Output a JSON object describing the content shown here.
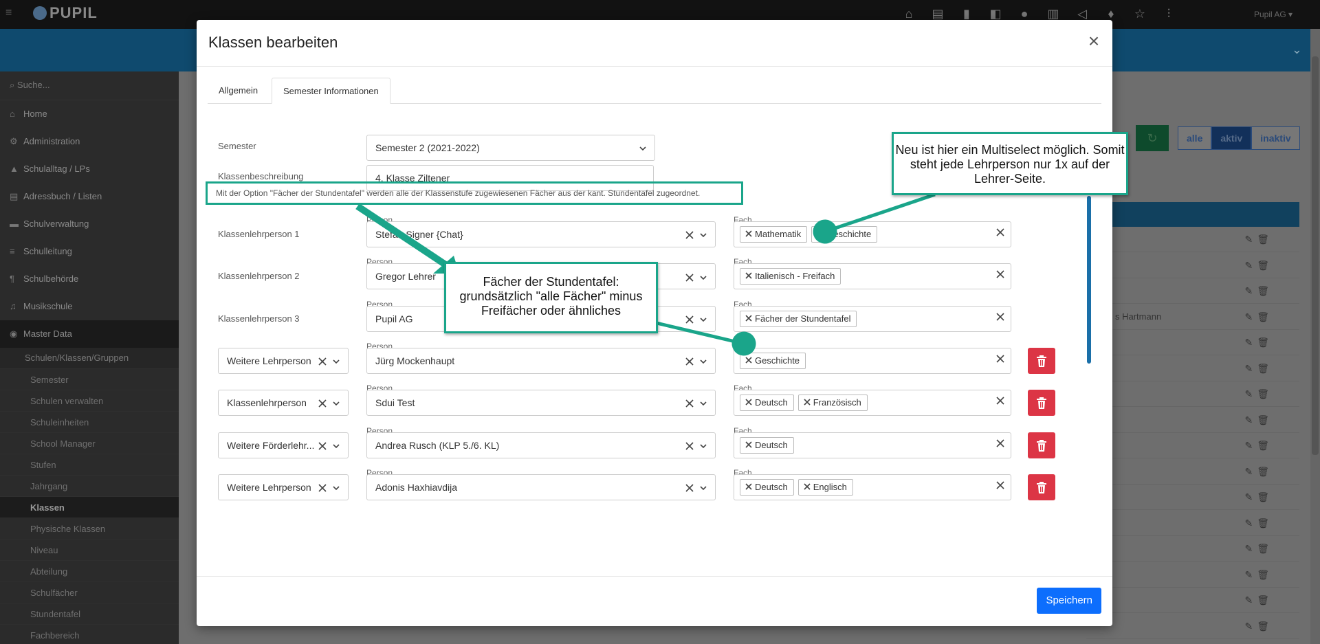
{
  "app": {
    "logo": "PUPIL",
    "user": "Pupil AG ▾",
    "search_placeholder": "Suche...",
    "nav": [
      {
        "label": "Home",
        "icon": "home-icon"
      },
      {
        "label": "Administration",
        "icon": "gear-icon"
      },
      {
        "label": "Schulalltag / LPs",
        "icon": "graduation-cap-icon"
      },
      {
        "label": "Adressbuch / Listen",
        "icon": "address-book-icon"
      },
      {
        "label": "Schulverwaltung",
        "icon": "folder-icon"
      },
      {
        "label": "Schulleitung",
        "icon": "sliders-icon"
      },
      {
        "label": "Schulbehörde",
        "icon": "paragraph-icon"
      },
      {
        "label": "Musikschule",
        "icon": "music-icon"
      },
      {
        "label": "Master Data",
        "icon": "database-icon"
      }
    ],
    "sub_head": "Schulen/Klassen/Gruppen",
    "sub_items": [
      "Semester",
      "Schulen verwalten",
      "Schuleinheiten",
      "School Manager",
      "Stufen",
      "Jahrgang",
      "Klassen",
      "Physische Klassen",
      "Niveau",
      "Abteilung",
      "Schulfächer",
      "Stundentafel",
      "Fachbereich"
    ],
    "filters": [
      "alle",
      "aktiv",
      "inaktiv"
    ],
    "bg_row_text": "s Hartmann"
  },
  "modal": {
    "title": "Klassen bearbeiten",
    "tabs": [
      "Allgemein",
      "Semester Informationen"
    ],
    "semester_label": "Semester",
    "semester_value": "Semester 2 (2021-2022)",
    "desc_label": "Klassenbeschreibung",
    "desc_value": "4. Klasse Ziltener",
    "info_note": "Mit der Option \"Fächer der Stundentafel\" werden alle der Klassenstufe zugewiesenen Fächer aus der kant. Stundentafel zugeordnet.",
    "person_label": "Person",
    "fach_label": "Fach",
    "rows": [
      {
        "role": "Klassenlehrperson 1",
        "person": "Stefan Signer {Chat}",
        "subjects": [
          "Mathematik",
          "Geschichte"
        ]
      },
      {
        "role": "Klassenlehrperson 2",
        "person": "Gregor Lehrer",
        "subjects": [
          "Italienisch - Freifach"
        ]
      },
      {
        "role": "Klassenlehrperson 3",
        "person": "Pupil AG",
        "subjects": [
          "Fächer der Stundentafel"
        ]
      },
      {
        "role_select": "Weitere Lehrperson",
        "person": "Jürg Mockenhaupt",
        "subjects": [
          "Geschichte"
        ]
      },
      {
        "role_select": "Klassenlehrperson",
        "person": "Sdui Test",
        "subjects": [
          "Deutsch",
          "Französisch"
        ]
      },
      {
        "role_select": "Weitere Förderlehr...",
        "person": "Andrea Rusch (KLP 5./6. KL)",
        "subjects": [
          "Deutsch"
        ]
      },
      {
        "role_select": "Weitere Lehrperson",
        "person": "Adonis Haxhiavdija",
        "subjects": [
          "Deutsch",
          "Englisch"
        ]
      }
    ],
    "save_label": "Speichern"
  },
  "annotations": {
    "multiselect": "Neu ist hier ein Multiselect möglich. Somit steht jede Lehrperson nur 1x auf der Lehrer-Seite.",
    "stundentafel": "Fächer der Stundentafel: grundsätzlich \"alle Fächer\" minus Freifächer oder ähnliches",
    "accent_color": "#1aa58a"
  }
}
